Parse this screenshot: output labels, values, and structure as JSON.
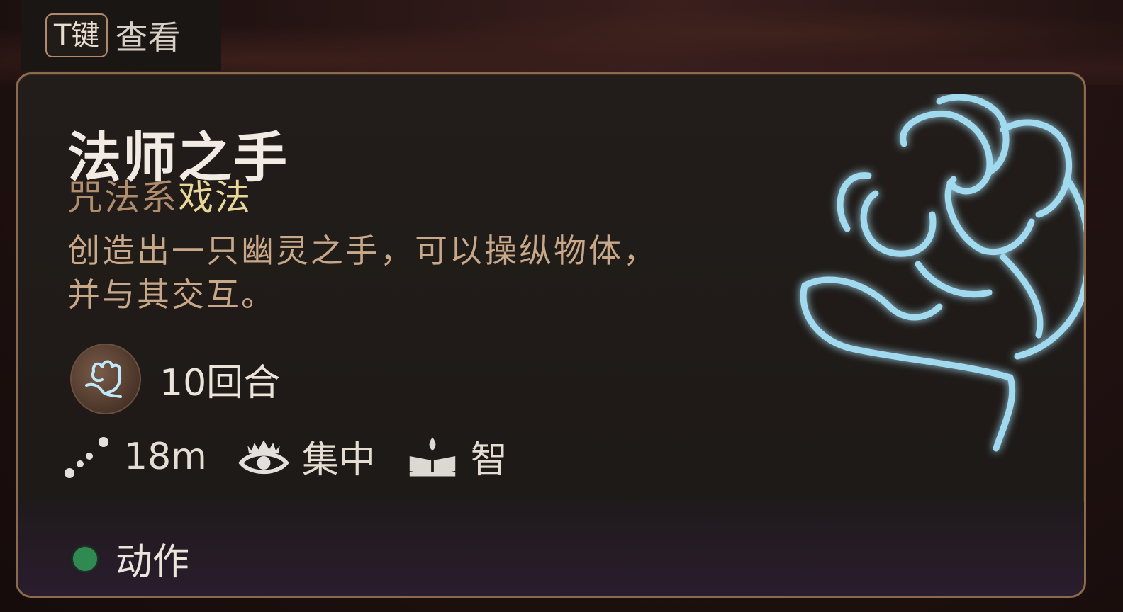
{
  "key_hint": {
    "key": "T键",
    "label": "查看"
  },
  "spell": {
    "name": "法师之手",
    "school_prefix": "咒法系",
    "school_type": "戏法",
    "description_lines": [
      "创造出一只幽灵之手，可以操纵物体，",
      "并与其交互。"
    ],
    "duration": "10回合",
    "range": "18m",
    "concentration": "集中",
    "spellcasting_ability": "智",
    "action_type": "动作"
  },
  "icons": {
    "spell": "mage-hand-icon",
    "range": "range-dots-icon",
    "concentration": "eye-icon",
    "ability": "spellbook-icon",
    "action": "green-dot-icon"
  },
  "colors": {
    "accent_gold": "#e9d79a",
    "school_brown": "#b08d6d",
    "border": "#8c6a4e",
    "action_green": "#2f8a52",
    "glow_blue": "#8fd6f5"
  }
}
